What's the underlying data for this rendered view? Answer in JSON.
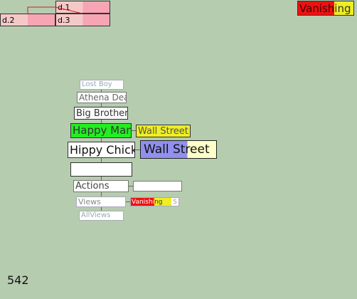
{
  "tree": {
    "d1": "d.1",
    "d2": "d.2",
    "d3": "d.3"
  },
  "badge_top": {
    "text_red": "Vanish",
    "text_yellow": "ing"
  },
  "stack": {
    "lost_boy": "Lost Boy",
    "athena": "Athena Dea",
    "big_brother": "Big Brother",
    "happy_man": "Happy Man",
    "wall_street_small": "Wall Street",
    "hippy_chick": "Hippy Chick",
    "wall_street_large": "Wall Street",
    "actions": "Actions",
    "views": "Views",
    "all_views": "AllViews",
    "vanishing_red": "Vanishi",
    "vanishing_yellow": "ng",
    "trailing_s": "S"
  },
  "counter": "542",
  "colors": {
    "background": "#b6ccaf",
    "green": "#22ee22",
    "yellow": "#eeee22",
    "blue": "#9090ee",
    "red": "#ee1111"
  }
}
